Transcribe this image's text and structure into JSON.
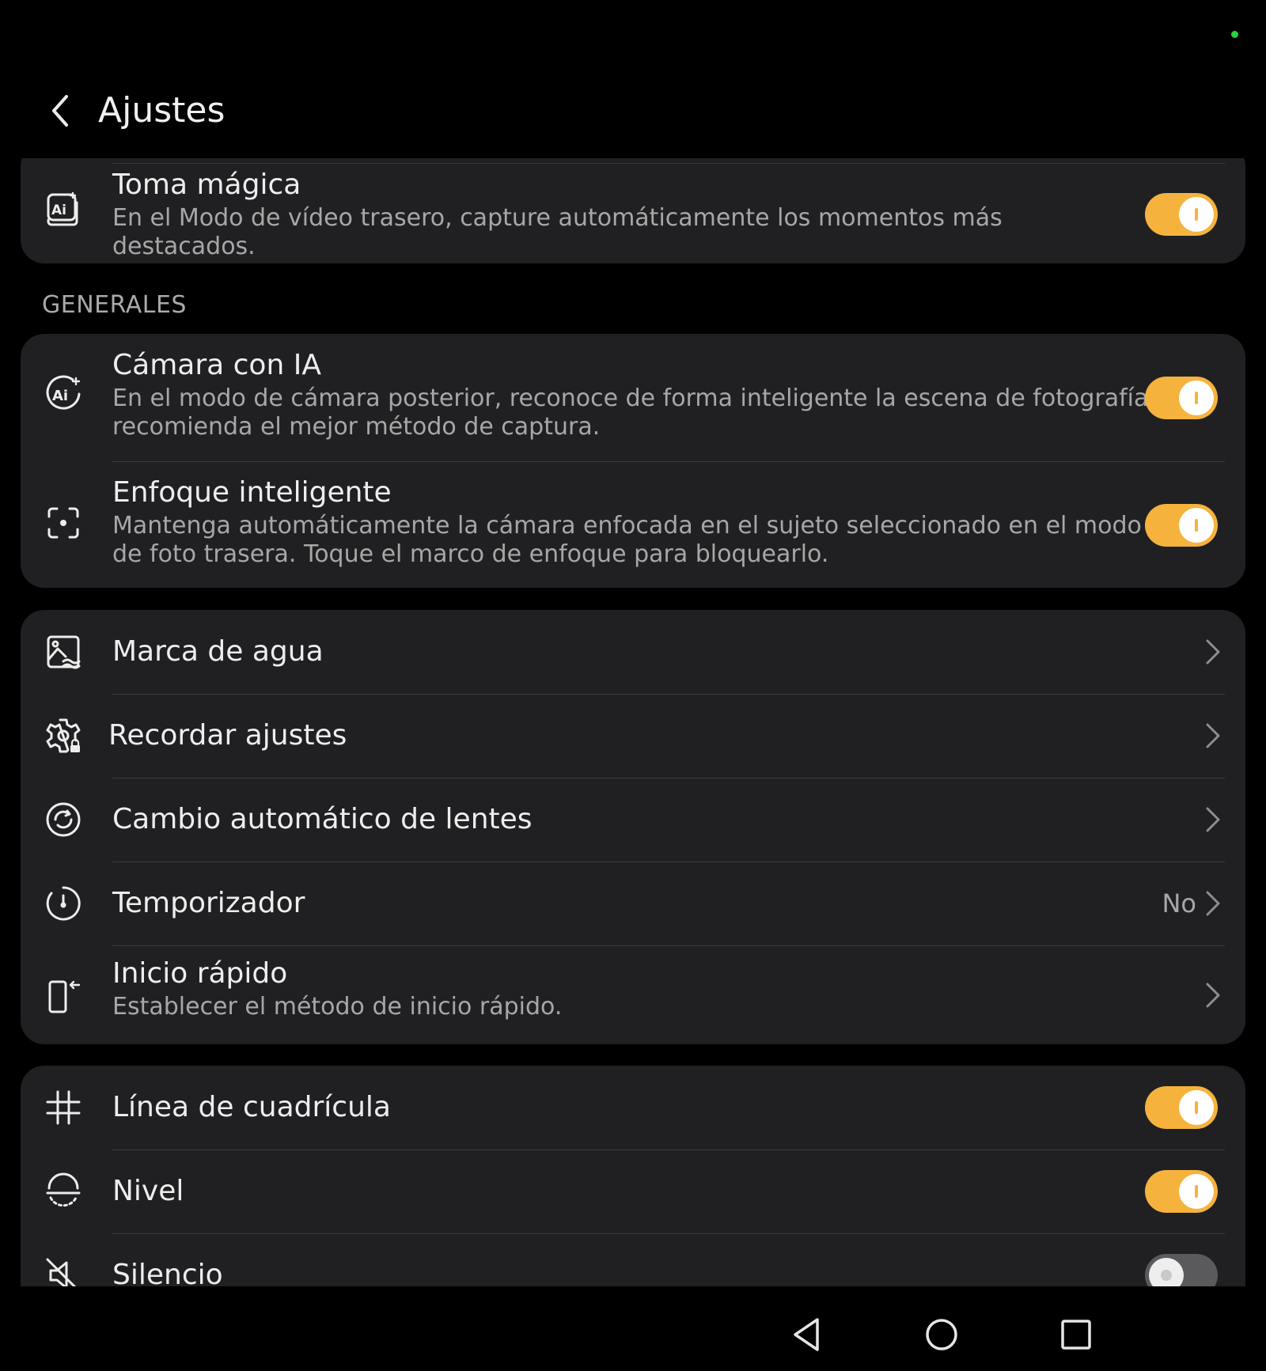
{
  "header": {
    "title": "Ajustes"
  },
  "group_top": {
    "magic_shot": {
      "title": "Toma mágica",
      "subtitle": "En el Modo de vídeo trasero, capture automáticamente los momentos más destacados.",
      "enabled": true
    }
  },
  "section_general": {
    "label": "GENERALES"
  },
  "group_ai": {
    "ai_camera": {
      "title": "Cámara con IA",
      "subtitle_line1": "En el modo de cámara posterior, reconoce de forma inteligente la escena de fotografía y",
      "subtitle_line2": "recomienda el mejor método de captura.",
      "enabled": true
    },
    "smart_focus": {
      "title": "Enfoque inteligente",
      "subtitle_line1": "Mantenga automáticamente la cámara enfocada en el sujeto seleccionado en el modo",
      "subtitle_line2": "de foto trasera. Toque el marco de enfoque para bloquearlo.",
      "enabled": true
    }
  },
  "group_nav": {
    "watermark": {
      "title": "Marca de agua"
    },
    "remember": {
      "title": "Recordar ajustes"
    },
    "lens_switch": {
      "title": "Cambio automático de lentes"
    },
    "timer": {
      "title": "Temporizador",
      "value": "No"
    },
    "quick_start": {
      "title": "Inicio rápido",
      "subtitle": "Establecer el método de inicio rápido."
    }
  },
  "group_toggles": {
    "grid": {
      "title": "Línea de cuadrícula",
      "enabled": true
    },
    "level": {
      "title": "Nivel",
      "enabled": true
    },
    "mute": {
      "title": "Silencio",
      "enabled": false
    }
  },
  "colors": {
    "accent": "#f5b33e",
    "card": "#202022",
    "background": "#000000",
    "status_dot": "#2ecc40"
  },
  "icons": {
    "back": "chevron-left-icon",
    "magic_shot": "ai-frame-icon",
    "ai_camera": "ai-circle-icon",
    "smart_focus": "focus-frame-icon",
    "watermark": "image-watermark-icon",
    "remember": "gear-lock-icon",
    "lens_switch": "lens-switch-icon",
    "timer": "timer-icon",
    "quick_start": "phone-quick-icon",
    "grid": "grid-icon",
    "level": "level-icon",
    "mute": "mute-icon"
  },
  "nav_bar": [
    "back-nav-icon",
    "home-nav-icon",
    "recents-nav-icon"
  ]
}
